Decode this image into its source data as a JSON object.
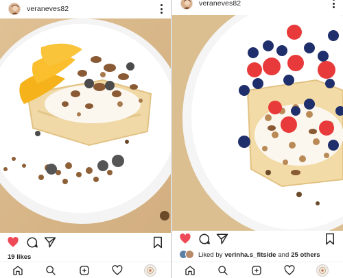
{
  "posts": [
    {
      "username": "veraneves82",
      "likes_text": "19 likes",
      "liked": true,
      "icons": {
        "avatar": "avatar",
        "more": "more-vertical-icon"
      }
    },
    {
      "username": "veraneves82",
      "liked_by": {
        "prefix": "Liked by",
        "user": "verinha.s_fitside",
        "joiner": "and",
        "others": "25 others"
      },
      "liked": true,
      "icons": {
        "avatar": "avatar",
        "more": "more-vertical-icon"
      }
    }
  ],
  "bottom_nav": [
    "home-icon",
    "search-icon",
    "new-post-icon",
    "activity-heart-icon",
    "profile-avatar"
  ],
  "colors": {
    "like_red": "#ed4956",
    "text": "#262626",
    "plate": "#ffffff",
    "table": "#d9b98b"
  }
}
